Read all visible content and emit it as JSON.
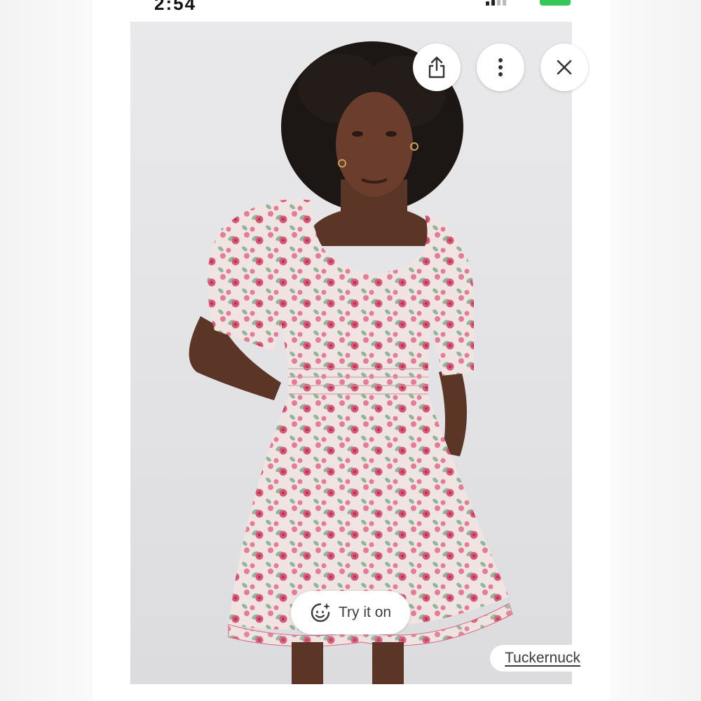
{
  "status_bar": {
    "time": "2:54",
    "battery_color": "#36c759"
  },
  "viewer": {
    "image_alt": "Woman wearing a pink floral short-sleeve smocked mini dress",
    "actions": {
      "share_icon": "share-icon",
      "more_icon": "more-vertical-icon",
      "close_icon": "close-icon"
    },
    "try_on": {
      "label": "Try it on",
      "icon": "try-on-face-sparkle-icon"
    },
    "source": {
      "label": "Tuckernuck"
    }
  },
  "colors": {
    "dress_base": "#efe4e2",
    "dress_flower": "#d85a78",
    "dress_leaf": "#8fb59a",
    "backdrop": "#e6e6e8"
  }
}
